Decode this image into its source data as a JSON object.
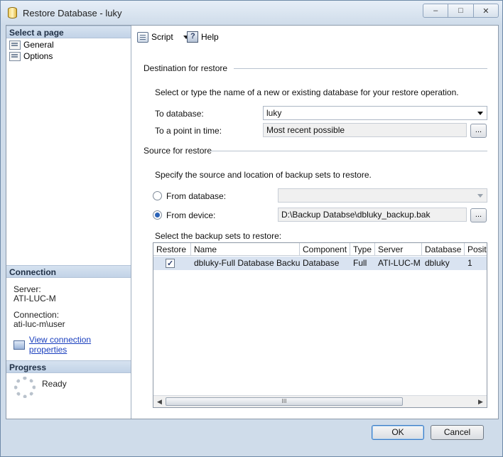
{
  "window": {
    "title": "Restore Database - luky",
    "caption_buttons": [
      "–",
      "□",
      "✕"
    ]
  },
  "sidebar": {
    "select_page_header": "Select a page",
    "pages": [
      {
        "label": "General"
      },
      {
        "label": "Options"
      }
    ],
    "connection_header": "Connection",
    "server_label": "Server:",
    "server_value": "ATI-LUC-M",
    "connection_label": "Connection:",
    "connection_value": "ati-luc-m\\user",
    "view_properties_link": "View connection properties",
    "progress_header": "Progress",
    "progress_status": "Ready"
  },
  "toolbar": {
    "script_label": "Script",
    "help_label": "Help"
  },
  "destination": {
    "section_title": "Destination for restore",
    "description": "Select or type the name of a new or existing database for your restore operation.",
    "to_database_label": "To database:",
    "to_database_value": "luky",
    "point_in_time_label": "To a point in time:",
    "point_in_time_value": "Most recent possible",
    "browse_label": "..."
  },
  "source": {
    "section_title": "Source for restore",
    "description": "Specify the source and location of backup sets to restore.",
    "from_database_label": "From database:",
    "from_database_value": "",
    "from_database_selected": false,
    "from_device_label": "From device:",
    "from_device_value": "D:\\Backup Databse\\dbluky_backup.bak",
    "from_device_selected": true,
    "browse_label": "...",
    "backup_sets_label": "Select the backup sets to restore:"
  },
  "backup_grid": {
    "columns": [
      "Restore",
      "Name",
      "Component",
      "Type",
      "Server",
      "Database",
      "Positi"
    ],
    "rows": [
      {
        "restore": true,
        "name": "dbluky-Full Database Backup",
        "component": "Database",
        "type": "Full",
        "server": "ATI-LUC-M",
        "database": "dbluky",
        "position": "1"
      }
    ],
    "scroll_thumb_grip": "III"
  },
  "footer": {
    "ok_label": "OK",
    "cancel_label": "Cancel"
  }
}
